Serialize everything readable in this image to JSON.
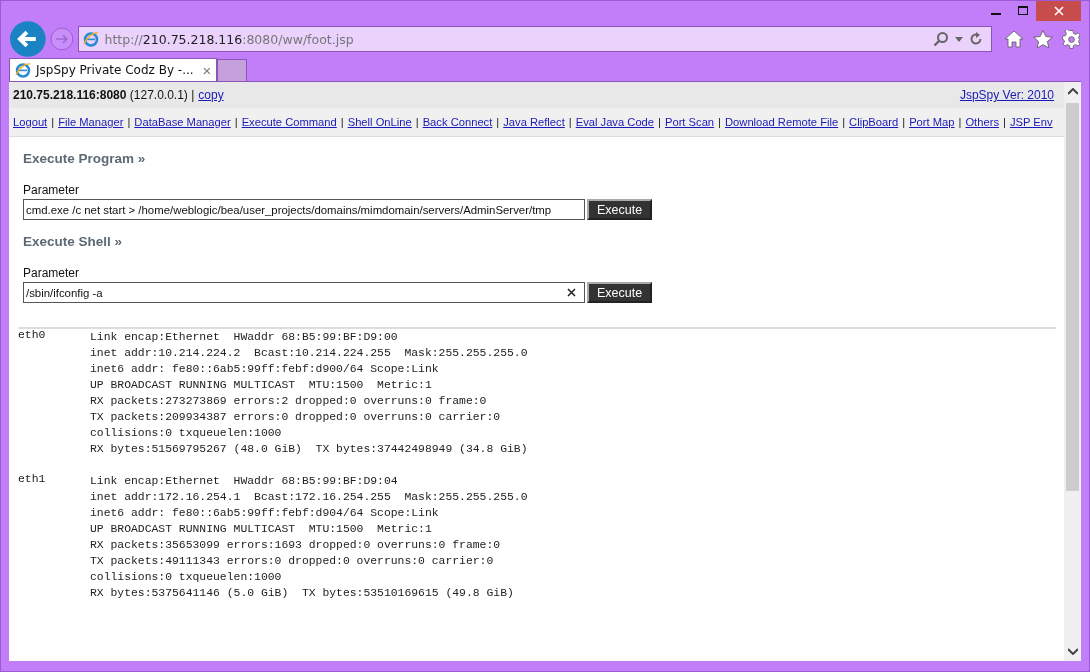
{
  "browser": {
    "url": {
      "scheme": "http://",
      "host": "210.75.218.116",
      "path": ":8080/ww/foot.jsp"
    },
    "tabs": [
      {
        "title": "JspSpy Private Codz By -...",
        "close": "×",
        "selected": true
      }
    ]
  },
  "header": {
    "server": "**210.75.218.116:8080** (127.0.0.1) |",
    "copy_link": "copy",
    "version_link": "JspSpy Ver: 2010"
  },
  "nav": {
    "separator": "|",
    "links": [
      "Logout",
      "File Manager",
      "DataBase Manager",
      "Execute Command",
      "Shell OnLine",
      "Back Connect",
      "Java Reflect",
      "Eval Java Code",
      "Port Scan",
      "Download Remote File",
      "ClipBoard",
      "Port Map",
      "Others",
      "JSP Env"
    ]
  },
  "sections": [
    {
      "title": "Execute Program »",
      "label": "Parameter",
      "value": "cmd.exe /c net start > /home/weblogic/bea/user_projects/domains/mimdomain/servers/AdminServer/tmp",
      "clearable": false,
      "button": "Execute"
    },
    {
      "title": "Execute Shell »",
      "label": "Parameter",
      "value": "/sbin/ifconfig -a",
      "clearable": true,
      "button": "Execute"
    }
  ],
  "output": [
    {
      "name": "eth0",
      "lines": [
        "Link encap:Ethernet  HWaddr 68:B5:99:BF:D9:00",
        "inet addr:10.214.224.2  Bcast:10.214.224.255  Mask:255.255.255.0",
        "inet6 addr: fe80::6ab5:99ff:febf:d900/64 Scope:Link",
        "UP BROADCAST RUNNING MULTICAST  MTU:1500  Metric:1",
        "RX packets:273273869 errors:2 dropped:0 overruns:0 frame:0",
        "TX packets:209934387 errors:0 dropped:0 overruns:0 carrier:0",
        "collisions:0 txqueuelen:1000",
        "RX bytes:51569795267 (48.0 GiB)  TX bytes:37442498949 (34.8 GiB)"
      ]
    },
    {
      "name": "eth1",
      "lines": [
        "Link encap:Ethernet  HWaddr 68:B5:99:BF:D9:04",
        "inet addr:172.16.254.1  Bcast:172.16.254.255  Mask:255.255.255.0",
        "inet6 addr: fe80::6ab5:99ff:febf:d904/64 Scope:Link",
        "UP BROADCAST RUNNING MULTICAST  MTU:1500  Metric:1",
        "RX packets:35653099 errors:1693 dropped:0 overruns:0 frame:0",
        "TX packets:49111343 errors:0 dropped:0 overruns:0 carrier:0",
        "collisions:0 txqueuelen:1000",
        "RX bytes:5375641146 (5.0 GiB)  TX bytes:53510169615 (49.8 GiB)"
      ]
    }
  ]
}
